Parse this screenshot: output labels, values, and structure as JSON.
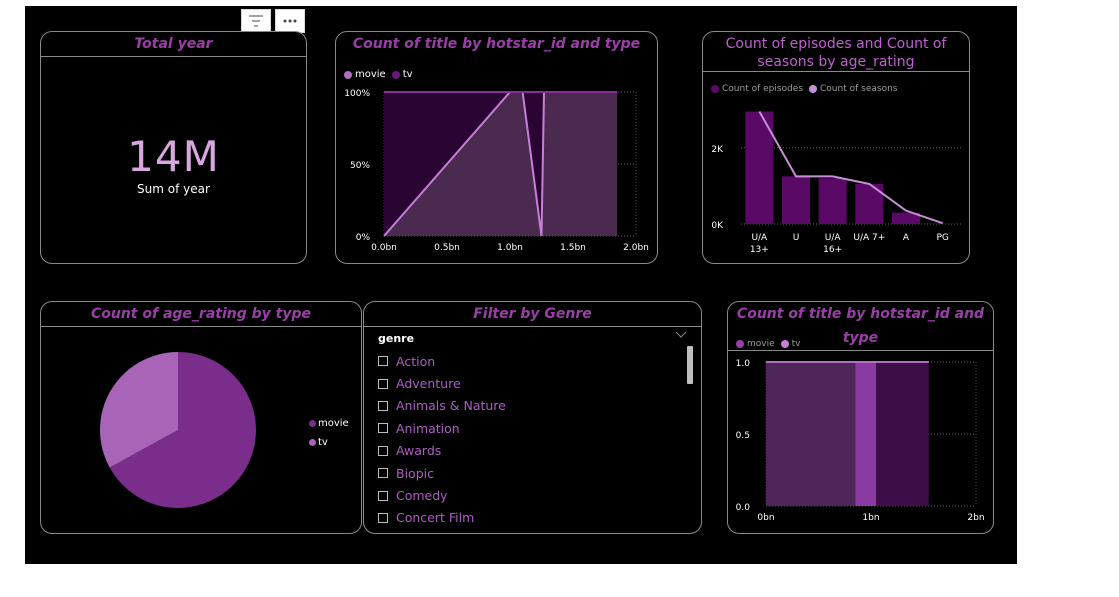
{
  "toolbar": {
    "filter_icon": "filter-lines-icon",
    "more_icon": "more-options-icon"
  },
  "colors": {
    "accent_title": "#9b3fa8",
    "movie": "#7b2d8b",
    "tv": "#c77ed6",
    "tv_light": "#b070c0",
    "bar": "#5a0a66",
    "line": "#c48fd6",
    "kpi": "#d9a6e0"
  },
  "kpi": {
    "title": "Total year",
    "value": "14M",
    "label": "Sum of year"
  },
  "chart_area": {
    "title": "Count of title by hotstar_id and type",
    "legend": [
      "movie",
      "tv"
    ],
    "y_ticks": [
      "100%",
      "50%",
      "0%"
    ],
    "x_ticks": [
      "0.0bn",
      "0.5bn",
      "1.0bn",
      "1.5bn",
      "2.0bn"
    ]
  },
  "chart_combo": {
    "title_line1": "Count of episodes and Count of",
    "title_line2": "seasons by age_rating",
    "legend": [
      "Count of episodes",
      "Count of seasons"
    ],
    "y_ticks": [
      "2K",
      "0K"
    ],
    "categories": [
      {
        "line1": "U/A",
        "line2": "13+"
      },
      {
        "line1": "U",
        "line2": ""
      },
      {
        "line1": "U/A",
        "line2": "16+"
      },
      {
        "line1": "U/A 7+",
        "line2": ""
      },
      {
        "line1": "A",
        "line2": ""
      },
      {
        "line1": "PG",
        "line2": ""
      }
    ]
  },
  "chart_pie": {
    "title": "Count of age_rating by type",
    "legend": [
      "movie",
      "tv"
    ]
  },
  "slicer": {
    "title": "Filter by Genre",
    "field": "genre",
    "items": [
      "Action",
      "Adventure",
      "Animals & Nature",
      "Animation",
      "Awards",
      "Biopic",
      "Comedy",
      "Concert Film"
    ]
  },
  "chart_area2": {
    "title": "Count of title by hotstar_id and type",
    "legend": [
      "movie",
      "tv"
    ],
    "y_ticks": [
      "1.0",
      "0.5",
      "0.0"
    ],
    "x_ticks": [
      "0bn",
      "1bn",
      "2bn"
    ]
  },
  "chart_data": [
    {
      "type": "area",
      "title": "Count of title by hotstar_id and type",
      "xlabel": "",
      "ylabel": "",
      "x": [
        0.0,
        1.0,
        1.1,
        1.25,
        1.27,
        1.85
      ],
      "series": [
        {
          "name": "movie",
          "values": [
            0,
            100,
            100,
            0,
            100,
            100
          ]
        },
        {
          "name": "tv",
          "values": [
            100,
            100,
            100,
            100,
            100,
            100
          ]
        }
      ],
      "xlim": [
        0,
        2.0
      ],
      "ylim": [
        0,
        100
      ],
      "grid": true,
      "legend": "top-left"
    },
    {
      "type": "bar",
      "title": "Count of episodes and Count of seasons by age_rating",
      "categories": [
        "U/A 13+",
        "U",
        "U/A 16+",
        "U/A 7+",
        "A",
        "PG"
      ],
      "series": [
        {
          "name": "Count of episodes",
          "values": [
            2950,
            1250,
            1200,
            1050,
            300,
            10
          ]
        },
        {
          "name": "Count of seasons",
          "values": [
            2950,
            1250,
            1250,
            1050,
            350,
            20
          ]
        }
      ],
      "ylim": [
        0,
        3200
      ],
      "grid": true,
      "legend": "top-left"
    },
    {
      "type": "pie",
      "title": "Count of age_rating by type",
      "categories": [
        "movie",
        "tv"
      ],
      "values": [
        67,
        33
      ],
      "legend": "right"
    },
    {
      "type": "area",
      "title": "Count of title by hotstar_id and type",
      "x": [
        0.0,
        0.85,
        1.05,
        1.55
      ],
      "series": [
        {
          "name": "movie",
          "values": [
            1.0,
            1.0,
            1.0,
            1.0
          ]
        },
        {
          "name": "tv",
          "values": [
            1.0,
            1.0,
            1.0,
            1.0
          ]
        }
      ],
      "xlim": [
        0,
        1.75
      ],
      "ylim": [
        0,
        1.0
      ],
      "grid": true,
      "legend": "top-left"
    }
  ]
}
